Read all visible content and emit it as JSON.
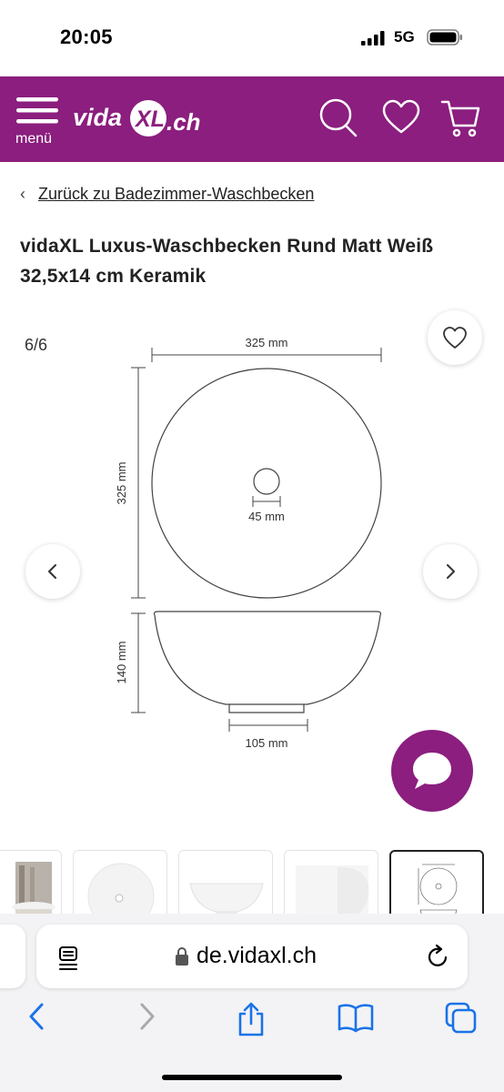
{
  "status_bar": {
    "time": "20:05",
    "network": "5G"
  },
  "header": {
    "menu_label": "menü",
    "logo_text_left": "vida",
    "logo_text_mid": "XL",
    "logo_text_right": ".ch",
    "icons": [
      "menu-icon",
      "search-icon",
      "heart-icon",
      "cart-icon"
    ],
    "brand_color": "#8b1e7e"
  },
  "breadcrumb": {
    "back_label": "Zurück zu Badezimmer-Waschbecken"
  },
  "product": {
    "title": "vidaXL Luxus-Waschbecken Rund Matt Weiß 32,5x14 cm Keramik"
  },
  "gallery": {
    "counter": "6/6",
    "drawing_labels": {
      "top_width": "325 mm",
      "side_height": "325 mm",
      "drain": "45 mm",
      "depth": "140 mm",
      "base": "105 mm"
    },
    "thumbnails": [
      "lifestyle-photo",
      "top-view",
      "side-view",
      "angle-view",
      "dimension-drawing"
    ],
    "active_thumbnail": 5
  },
  "browser": {
    "url": "de.vidaxl.ch",
    "toolbar_icons": [
      "back-icon",
      "forward-icon",
      "share-icon",
      "bookmarks-icon",
      "tabs-icon"
    ]
  }
}
